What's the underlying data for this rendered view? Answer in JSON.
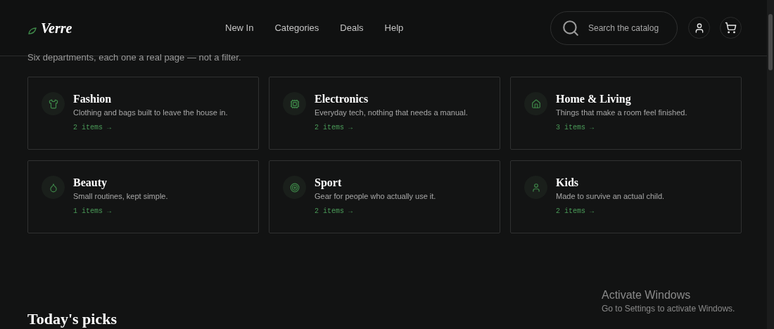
{
  "header": {
    "logo": "Verre",
    "nav": [
      "New In",
      "Categories",
      "Deals",
      "Help"
    ],
    "search": {
      "placeholder": "Search the catalog"
    }
  },
  "intro": "Six departments, each one a real page — not a filter.",
  "categories": [
    {
      "name": "Fashion",
      "description": "Clothing and bags built to leave the house in.",
      "count": "2 items →"
    },
    {
      "name": "Electronics",
      "description": "Everyday tech, nothing that needs a manual.",
      "count": "2 items →"
    },
    {
      "name": "Home & Living",
      "description": "Things that make a room feel finished.",
      "count": "3 items →"
    },
    {
      "name": "Beauty",
      "description": "Small routines, kept simple.",
      "count": "1 items →"
    },
    {
      "name": "Sport",
      "description": "Gear for people who actually use it.",
      "count": "2 items →"
    },
    {
      "name": "Kids",
      "description": "Made to survive an actual child.",
      "count": "2 items →"
    }
  ],
  "section_title": "Today's picks",
  "os_notice": {
    "title": "Activate Windows",
    "text": "Go to Settings to activate Windows."
  }
}
